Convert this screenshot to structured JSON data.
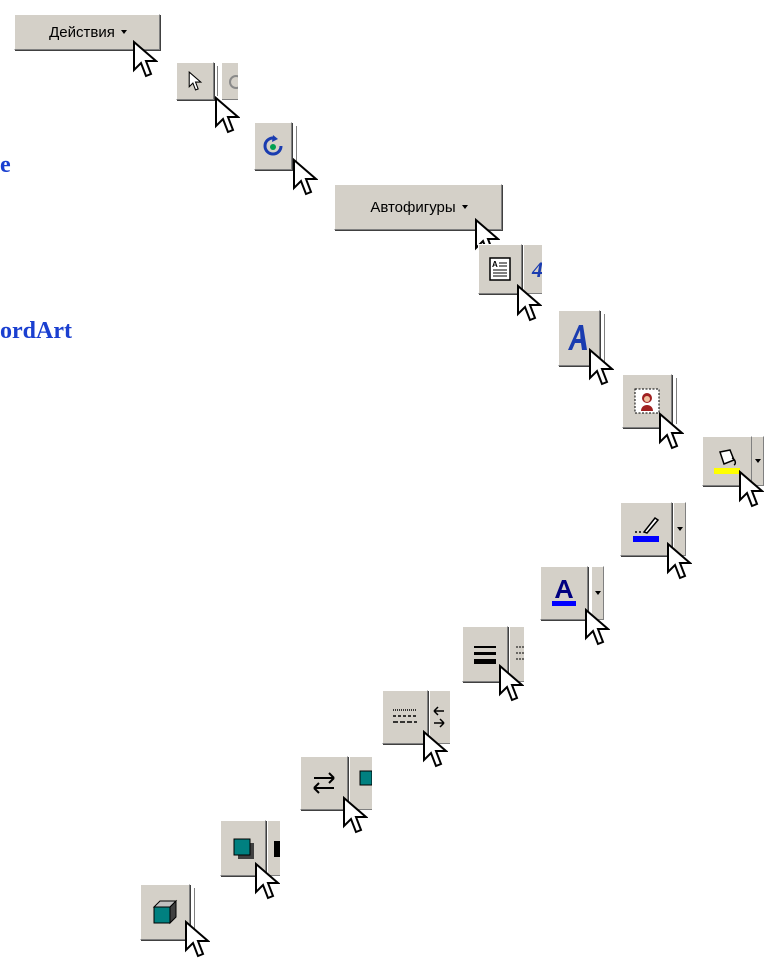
{
  "side_labels": {
    "line1": "e",
    "line2": "ordArt"
  },
  "toolbar": {
    "actions_label": "Действия",
    "autoshapes_label": "Автофигуры"
  },
  "icons": [
    "dropdown-arrow-icon",
    "select-arrow-icon",
    "free-rotate-icon",
    "text-box-icon",
    "wordart-icon",
    "picture-icon",
    "fill-color-icon",
    "line-color-icon",
    "font-color-icon",
    "line-style-icon",
    "dash-style-icon",
    "arrow-style-icon",
    "shadow-icon",
    "3d-icon",
    "mouse-cursor-icon"
  ],
  "colors": {
    "side_text": "#1a3fd0",
    "button_face": "#d4d0c8",
    "fill_yellow": "#ffff00",
    "line_blue": "#0000ff",
    "teal": "#008080"
  }
}
